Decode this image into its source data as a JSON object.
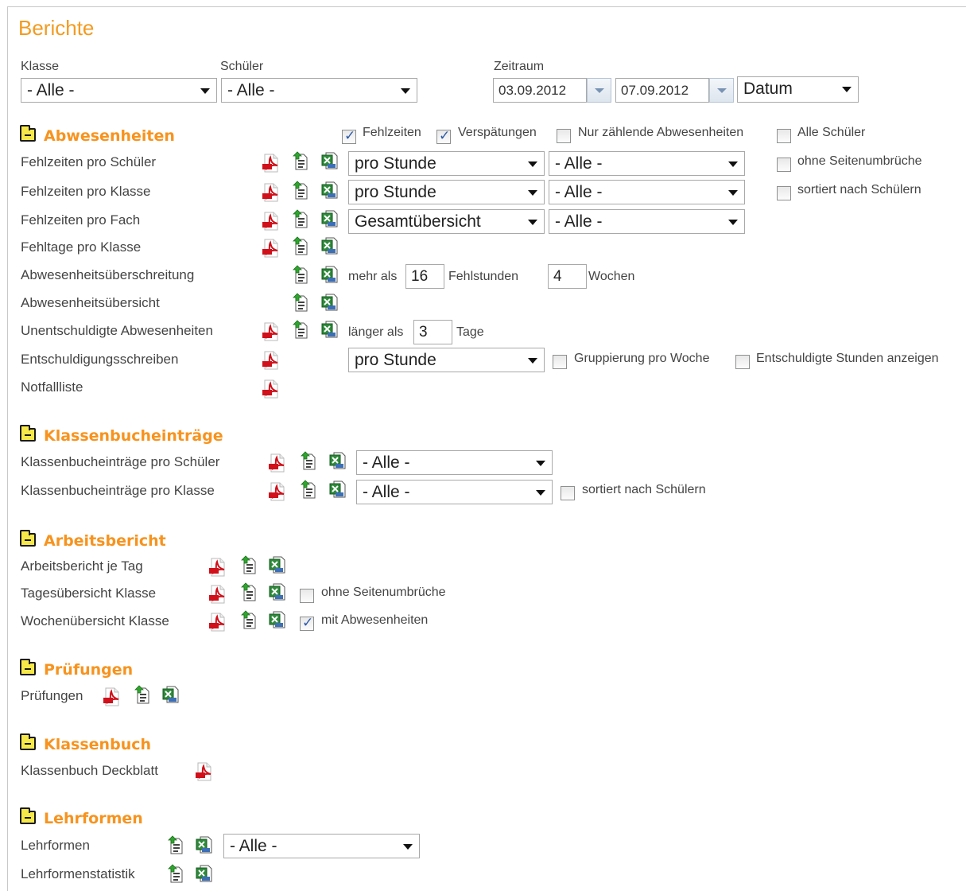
{
  "page": {
    "title": "Berichte"
  },
  "filters": {
    "klasse_label": "Klasse",
    "klasse_value": "- Alle -",
    "schueler_label": "Schüler",
    "schueler_value": "- Alle -",
    "zeitraum_label": "Zeitraum",
    "date_from": "03.09.2012",
    "date_to": "07.09.2012",
    "date_mode": "Datum"
  },
  "abwesenheiten": {
    "title": "Abwesenheiten",
    "opt_fehlzeiten": "Fehlzeiten",
    "opt_verspaetungen": "Verspätungen",
    "opt_nur_zaehlende": "Nur zählende Abwesenheiten",
    "opt_alle_schueler": "Alle Schüler",
    "rows": [
      {
        "label": "Fehlzeiten pro Schüler",
        "sel1": "pro Stunde",
        "sel2": "- Alle -",
        "extra": "ohne Seitenumbrüche"
      },
      {
        "label": "Fehlzeiten pro Klasse",
        "sel1": "pro Stunde",
        "sel2": "- Alle -",
        "extra": "sortiert nach Schülern"
      },
      {
        "label": "Fehlzeiten pro Fach",
        "sel1": "Gesamtübersicht",
        "sel2": "- Alle -"
      },
      {
        "label": "Fehltage pro Klasse"
      },
      {
        "label": "Abwesenheitsüberschreitung",
        "pre": "mehr als",
        "val1": "16",
        "mid": "Fehlstunden",
        "val2": "4",
        "post": "Wochen"
      },
      {
        "label": "Abwesenheitsübersicht"
      },
      {
        "label": "Unentschuldigte Abwesenheiten",
        "pre": "länger als",
        "val1": "3",
        "post": "Tage"
      },
      {
        "label": "Entschuldigungsschreiben",
        "sel1": "pro Stunde",
        "opt1": "Gruppierung pro Woche",
        "opt2": "Entschuldigte Stunden anzeigen"
      },
      {
        "label": "Notfallliste"
      }
    ]
  },
  "klassenbuch_eintraege": {
    "title": "Klassenbucheinträge",
    "rows": [
      {
        "label": "Klassenbucheinträge pro Schüler",
        "sel": "- Alle -"
      },
      {
        "label": "Klassenbucheinträge pro Klasse",
        "sel": "- Alle -",
        "extra": "sortiert nach Schülern"
      }
    ]
  },
  "arbeitsbericht": {
    "title": "Arbeitsbericht",
    "rows": [
      {
        "label": "Arbeitsbericht je Tag"
      },
      {
        "label": "Tagesübersicht Klasse",
        "extra": "ohne Seitenumbrüche"
      },
      {
        "label": "Wochenübersicht Klasse",
        "extra": "mit Abwesenheiten"
      }
    ]
  },
  "pruefungen": {
    "title": "Prüfungen",
    "row_label": "Prüfungen"
  },
  "klassenbuch": {
    "title": "Klassenbuch",
    "row_label": "Klassenbuch Deckblatt"
  },
  "lehrformen": {
    "title": "Lehrformen",
    "row1_label": "Lehrformen",
    "row1_sel": "- Alle -",
    "row2_label": "Lehrformenstatistik"
  },
  "icons": {
    "pdf": "pdf-icon",
    "html": "html-export-icon",
    "excel": "excel-icon"
  },
  "colors": {
    "accent": "#f39b20",
    "section": "#f7931e",
    "checkmark": "#2b5aa8"
  }
}
